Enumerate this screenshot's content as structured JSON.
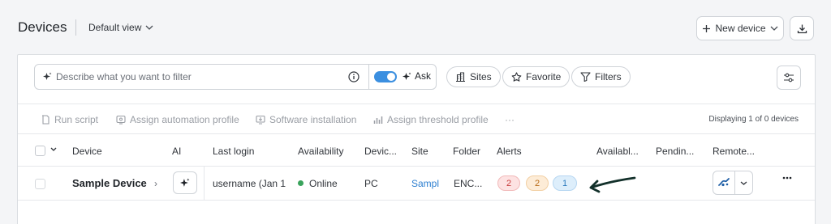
{
  "header": {
    "title": "Devices",
    "view_label": "Default view",
    "new_device_label": "New device"
  },
  "toolbar": {
    "search_placeholder": "Describe what you want to filter",
    "ask_label": "Ask",
    "ask_toggle_on": true,
    "sites_label": "Sites",
    "favorite_label": "Favorite",
    "filters_label": "Filters"
  },
  "actions": {
    "run_script": "Run script",
    "assign_automation": "Assign automation profile",
    "software_installation": "Software installation",
    "assign_threshold": "Assign threshold profile",
    "more": "···",
    "displaying": "Displaying 1 of 0 devices"
  },
  "table": {
    "columns": [
      "Device",
      "AI",
      "Last login",
      "Availability",
      "Devic...",
      "Site",
      "Folder",
      "Alerts",
      "Availabl...",
      "Pendin...",
      "Remote..."
    ],
    "rows": [
      {
        "device": "Sample Device",
        "device_suffix": "›",
        "last_login": "username (Jan 1",
        "availability": "Online",
        "device_type": "PC",
        "site": "Sampl",
        "folder": "ENC...",
        "alerts": {
          "critical": "2",
          "warning": "2",
          "info": "1"
        }
      }
    ]
  },
  "colors": {
    "accent": "#3b8fe0",
    "online": "#3aa35c",
    "alert_critical": "#c73c3c",
    "alert_warning": "#b86b16",
    "alert_info": "#2a79bd"
  },
  "icons": [
    "chevron-down-icon",
    "plus-icon",
    "download-icon",
    "sparkle-icon",
    "info-icon",
    "building-icon",
    "star-icon",
    "filter-icon",
    "sliders-icon",
    "script-icon",
    "profile-icon",
    "install-icon",
    "threshold-icon",
    "remote-icon",
    "kebab-icon",
    "arrow-annotation"
  ]
}
